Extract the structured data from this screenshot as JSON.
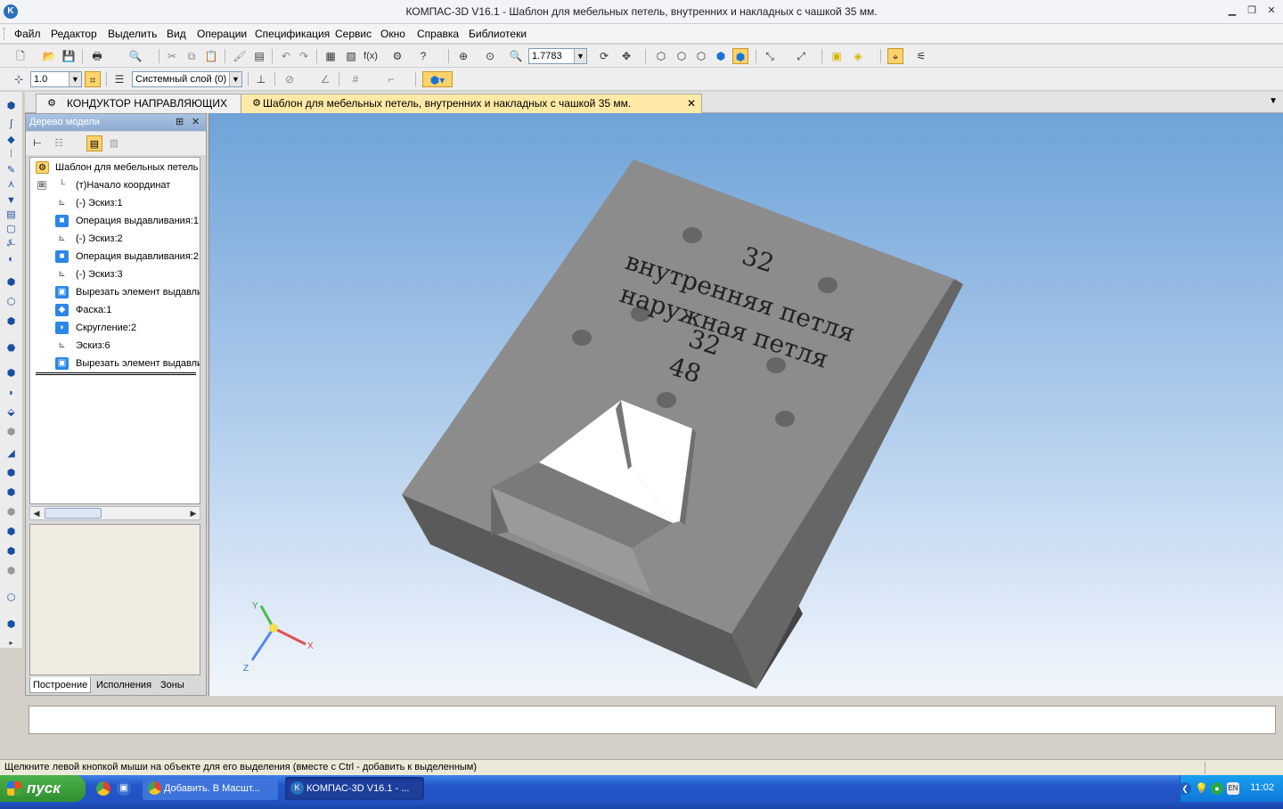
{
  "window": {
    "title": "КОМПАС-3D V16.1 - Шаблон для мебельных петель, внутренних и накладных с чашкой 35 мм.",
    "app_icon": "K"
  },
  "menu": [
    "Файл",
    "Редактор",
    "Выделить",
    "Вид",
    "Операции",
    "Спецификация",
    "Сервис",
    "Окно",
    "Справка",
    "Библиотеки"
  ],
  "toolbar": {
    "zoom_value": "1.7783",
    "step_value": "1.0",
    "layer_value": "Системный слой (0)"
  },
  "tabs": [
    {
      "label": "КОНДУКТОР НАПРАВЛЯЮЩИХ",
      "icon": "part-icon"
    },
    {
      "label": "Шаблон для мебельных петель, внутренних и накладных с чашкой 35 мм.",
      "icon": "part-icon",
      "close": "✕"
    }
  ],
  "tree": {
    "header": "Дерево модели",
    "pin": "⊞",
    "close": "✕",
    "expand": "⊞",
    "items": [
      {
        "label": "Шаблон для мебельных петель",
        "icon": "part-icon"
      },
      {
        "label": "(т)Начало координат",
        "icon": "origin-icon"
      },
      {
        "label": "(-) Эскиз:1",
        "icon": "sketch-icon"
      },
      {
        "label": "Операция выдавливания:1",
        "icon": "extrude-icon"
      },
      {
        "label": "(-) Эскиз:2",
        "icon": "sketch-icon"
      },
      {
        "label": "Операция выдавливания:2",
        "icon": "extrude-icon"
      },
      {
        "label": "(-) Эскиз:3",
        "icon": "sketch-icon"
      },
      {
        "label": "Вырезать элемент выдавли",
        "icon": "cut-icon"
      },
      {
        "label": "Фаска:1",
        "icon": "chamfer-icon"
      },
      {
        "label": "Скругление:2",
        "icon": "fillet-icon"
      },
      {
        "label": "Эскиз:6",
        "icon": "sketch-icon"
      },
      {
        "label": "Вырезать элемент выдавли",
        "icon": "cut-icon"
      }
    ],
    "bottom_tabs": [
      "Построение",
      "Исполнения",
      "Зоны"
    ]
  },
  "model": {
    "text_32_top": "32",
    "text_inner": "внутренняя петля",
    "text_outer": "наружная петля",
    "text_32_mid": "32",
    "text_48": "48",
    "axes": {
      "x": "X",
      "y": "Y",
      "z": "Z"
    }
  },
  "status": "Щелкните левой кнопкой мыши на объекте для его выделения (вместе с Ctrl - добавить к выделенным)",
  "taskbar": {
    "start": "пуск",
    "items": [
      "Добавить. В Масшт...",
      "КОМПАС-3D V16.1 - ..."
    ],
    "time": "11:02",
    "lang": "EN"
  },
  "colors": {
    "viewport_top": "#6fa3d8",
    "part_face": "#8c8c8c",
    "tab_active": "#ffe9a6",
    "taskbar": "#2457c8"
  }
}
